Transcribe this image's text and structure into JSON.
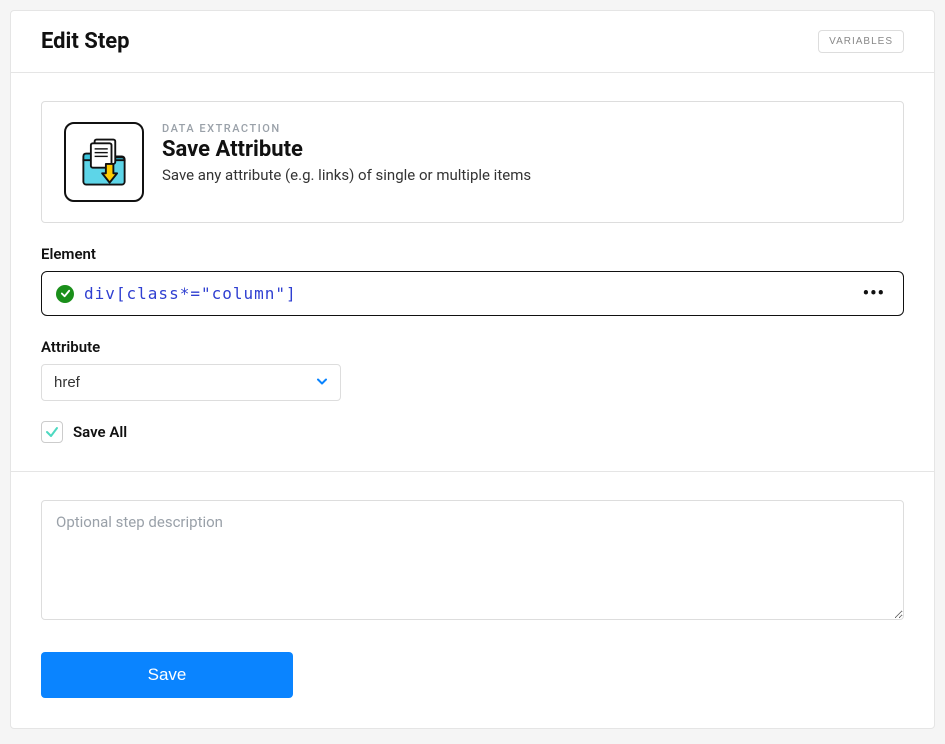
{
  "header": {
    "title": "Edit Step",
    "variables_btn": "VARIABLES"
  },
  "step": {
    "category": "DATA EXTRACTION",
    "title": "Save Attribute",
    "description": "Save any attribute (e.g. links) of single or multiple items"
  },
  "element": {
    "label": "Element",
    "selector": "div[class*=\"column\"]",
    "valid": true
  },
  "attribute": {
    "label": "Attribute",
    "value": "href",
    "options": [
      "href"
    ]
  },
  "save_all": {
    "label": "Save All",
    "checked": true
  },
  "description": {
    "placeholder": "Optional step description",
    "value": ""
  },
  "footer": {
    "save_btn": "Save"
  }
}
